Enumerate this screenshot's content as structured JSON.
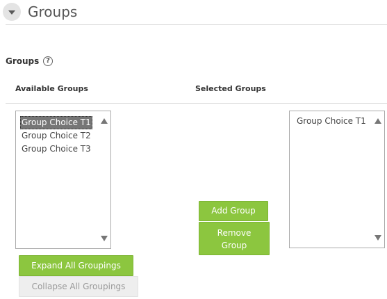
{
  "section": {
    "title": "Groups"
  },
  "field": {
    "label": "Groups",
    "help_glyph": "?"
  },
  "available": {
    "header": "Available Groups",
    "options": [
      "Group Choice T1",
      "Group Choice T2",
      "Group Choice T3"
    ],
    "selected_index": 0
  },
  "selected": {
    "header": "Selected Groups",
    "options": [
      "Group Choice T1"
    ]
  },
  "actions": {
    "add_label": "Add Group",
    "remove_label_line1": "Remove",
    "remove_label_line2": "Group",
    "expand_label": "Expand All Groupings",
    "collapse_label": "Collapse All Groupings"
  },
  "icons": {
    "toggle": "chevron-down-icon",
    "help": "help-icon",
    "scroll_up": "scroll-up-arrow-icon",
    "scroll_down": "scroll-down-arrow-icon"
  },
  "colors": {
    "accent_green": "#8cc63f",
    "selected_option_bg": "#767676",
    "disabled_button_bg": "#eeeeee"
  }
}
